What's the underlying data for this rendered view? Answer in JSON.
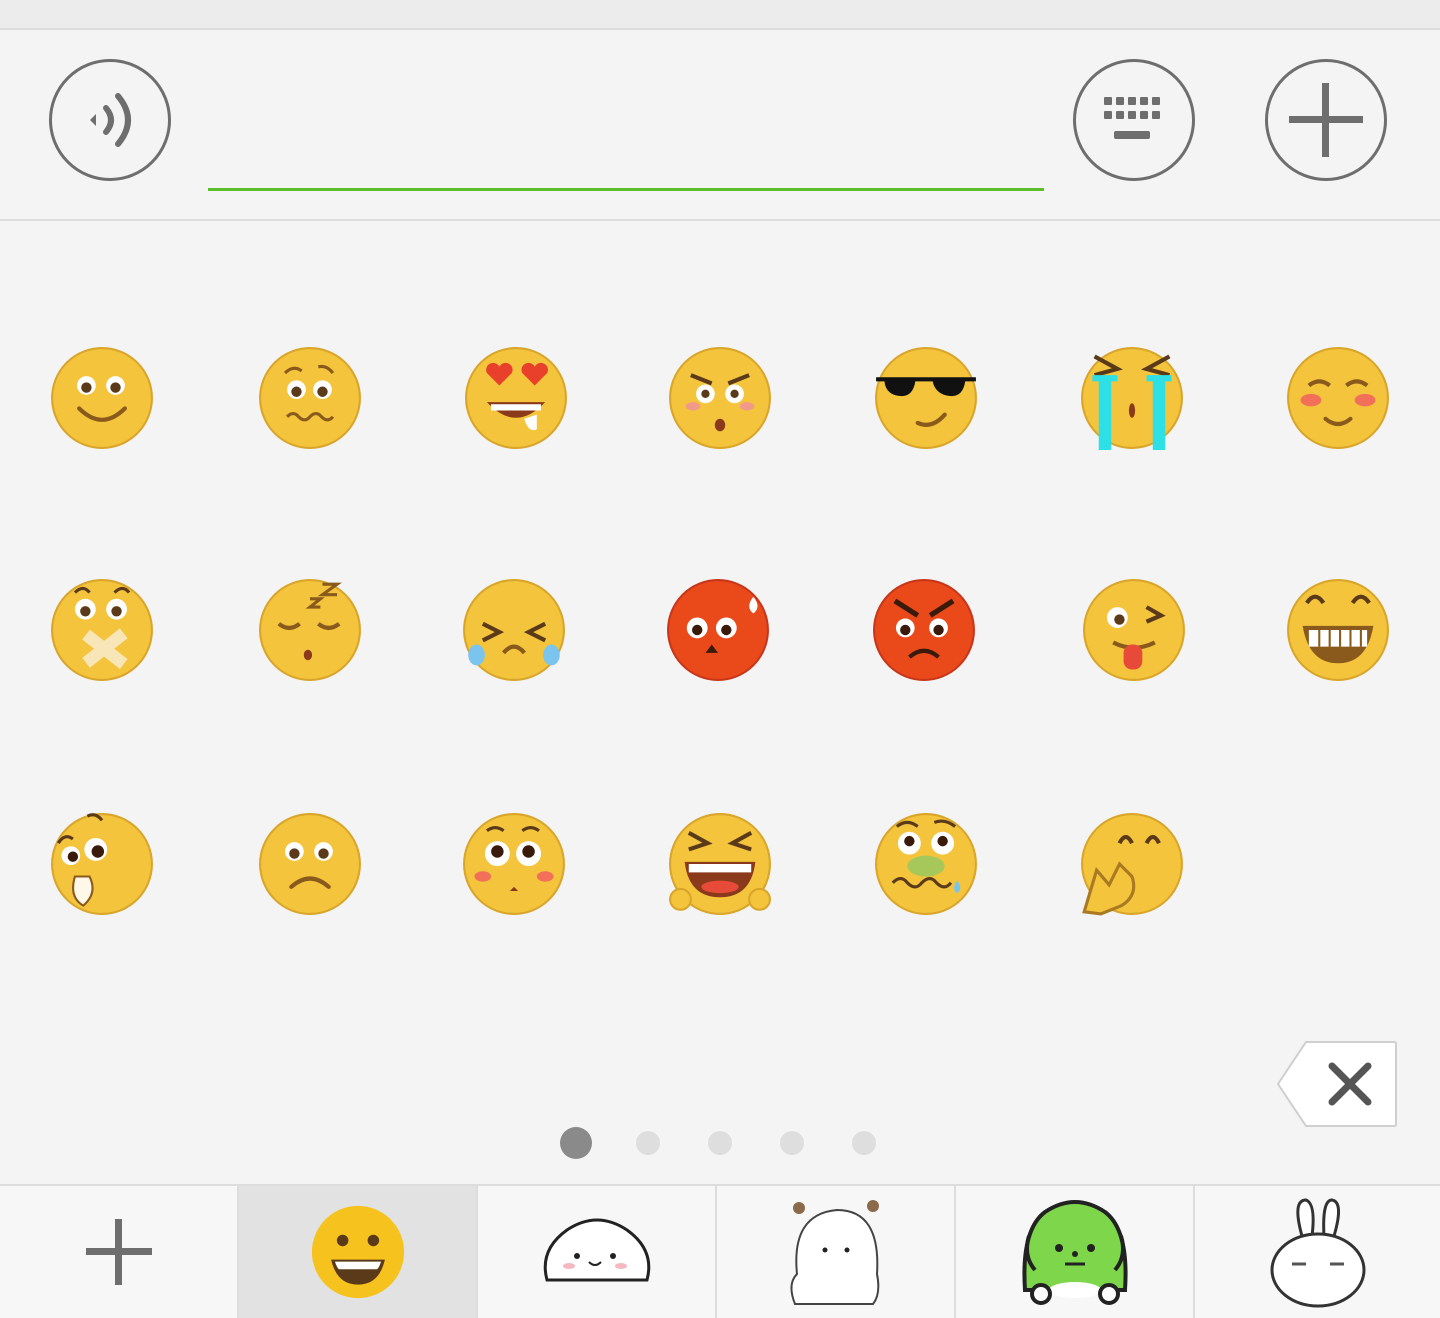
{
  "input_bar": {
    "voice_icon": "voice-wave-icon",
    "text_value": "",
    "keyboard_icon": "keyboard-icon",
    "more_icon": "plus-icon",
    "accent_color": "#5cbf2a"
  },
  "emoji_panel": {
    "page_count": 5,
    "current_page": 1,
    "rows": [
      [
        "smile",
        "awkward",
        "heart-eyes",
        "shocked",
        "cool",
        "sobbing",
        "shy"
      ],
      [
        "zip-mouth",
        "sleepy",
        "tearful",
        "embarrassed-red",
        "angry-red",
        "tongue-wink",
        "grin"
      ],
      [
        "surprised",
        "sad",
        "blushing-eyes",
        "screaming",
        "nauseous",
        "chuckle"
      ]
    ],
    "delete_icon": "backspace-icon"
  },
  "tabs": [
    {
      "icon": "plus-icon",
      "selected": false
    },
    {
      "icon": "smiley-face-icon",
      "selected": true
    },
    {
      "icon": "white-bun-sticker-icon",
      "selected": false
    },
    {
      "icon": "white-bear-sticker-icon",
      "selected": false
    },
    {
      "icon": "green-dog-sticker-icon",
      "selected": false
    },
    {
      "icon": "white-rabbit-sticker-icon",
      "selected": false
    }
  ]
}
